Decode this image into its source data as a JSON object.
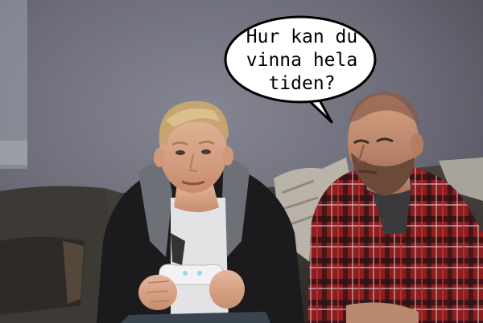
{
  "speech_bubble": {
    "lines": [
      "Hur kan du",
      "vinna hela",
      "tiden?"
    ]
  },
  "scene_objects": {
    "left_person": "young blond man in black hoodie holding white game controller",
    "right_person": "bald bearded man in red plaid shirt",
    "controller": "white game controller",
    "couch": "dark grey sofa"
  },
  "colors": {
    "wall": "#6d6e7a",
    "couch": "#3a3836",
    "hoodie": "#1b1a1c",
    "plaid_red": "#8e1d1f",
    "bubble_fill": "#ffffff",
    "bubble_stroke": "#000000"
  }
}
